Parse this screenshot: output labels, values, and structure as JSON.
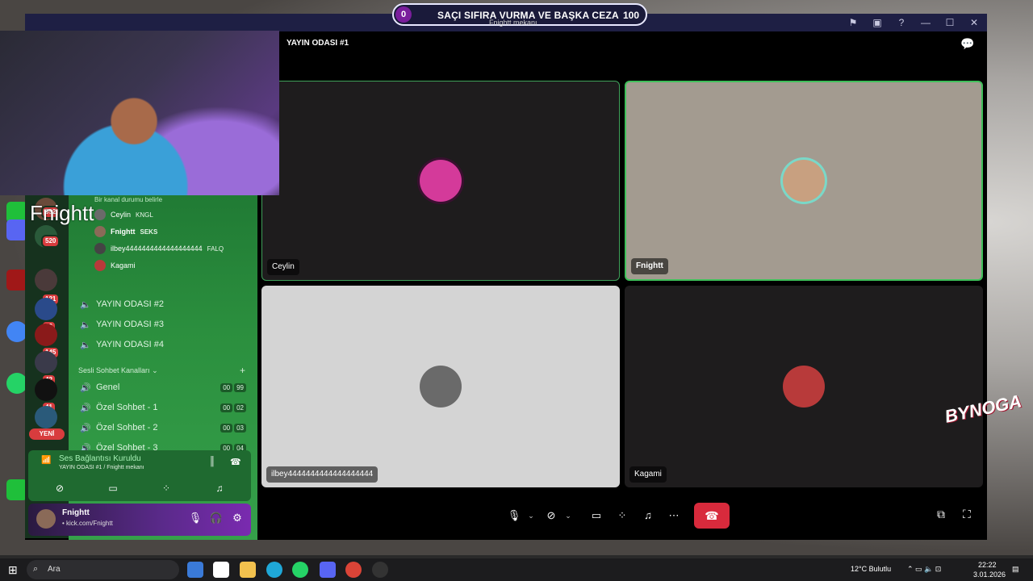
{
  "banner": {
    "left_score": "0",
    "text": "SAÇI SIFIRA VURMA VE BAŞKA CEZA",
    "right_score": "100",
    "subtitle": "Fnightt mekanı"
  },
  "webcam": {
    "name": "Fnightt"
  },
  "window": {
    "channel_title": "YAYIN ODASI #1"
  },
  "server_badges": [
    "992",
    "520",
    "121",
    "16",
    "145",
    "42",
    "41"
  ],
  "new_badge": "YENİ",
  "channels": {
    "status_prompt": "Bir kanal durumu belirle",
    "members": [
      {
        "name": "Ceylin",
        "tag": "KNGL"
      },
      {
        "name": "Fnightt",
        "tag": "SEKS"
      },
      {
        "name": "ilbey4444444444444444444",
        "tag": "FALQ"
      },
      {
        "name": "Kagami",
        "tag": ""
      }
    ],
    "voice_rooms": [
      "YAYIN ODASI #2",
      "YAYIN ODASI #3",
      "YAYIN ODASI #4"
    ],
    "category": "Sesli Sohbet Kanalları",
    "voice_chats": [
      {
        "name": "Genel",
        "a": "00",
        "b": "99"
      },
      {
        "name": "Özel Sohbet - 1",
        "a": "00",
        "b": "02"
      },
      {
        "name": "Özel Sohbet - 2",
        "a": "00",
        "b": "03"
      },
      {
        "name": "Özel Sohbet - 3",
        "a": "00",
        "b": "04"
      }
    ]
  },
  "voice_panel": {
    "title": "Ses Bağlantısı Kuruldu",
    "subtitle": "YAYIN ODASI #1 / Fnightt mekanı"
  },
  "user_panel": {
    "name": "Fnightt",
    "status": "• kick.com/Fnightt"
  },
  "tiles": [
    {
      "name": "Ceylin",
      "bg": "#1e1c1d",
      "border": "#3fa05a",
      "avatar": "#d43a9a"
    },
    {
      "name": "Fnightt",
      "bg": "#a39b90",
      "border": "#3fc05a",
      "avatar": "#7ad8c8"
    },
    {
      "name": "ilbey4444444444444444444",
      "bg": "#d4d4d4",
      "border": "",
      "avatar": "#9a9a9a"
    },
    {
      "name": "Kagami",
      "bg": "#1e1c1d",
      "border": "",
      "avatar": "#b83a3a"
    }
  ],
  "watermark": "BYNOGA",
  "taskbar": {
    "search_placeholder": "Ara",
    "weather": "12°C Bulutlu",
    "time": "22:22",
    "date": "3.01.2026"
  },
  "colors": {
    "accent_green": "#2b8f3e",
    "hangup_red": "#d82a3c",
    "badge_red": "#d83c3e"
  }
}
